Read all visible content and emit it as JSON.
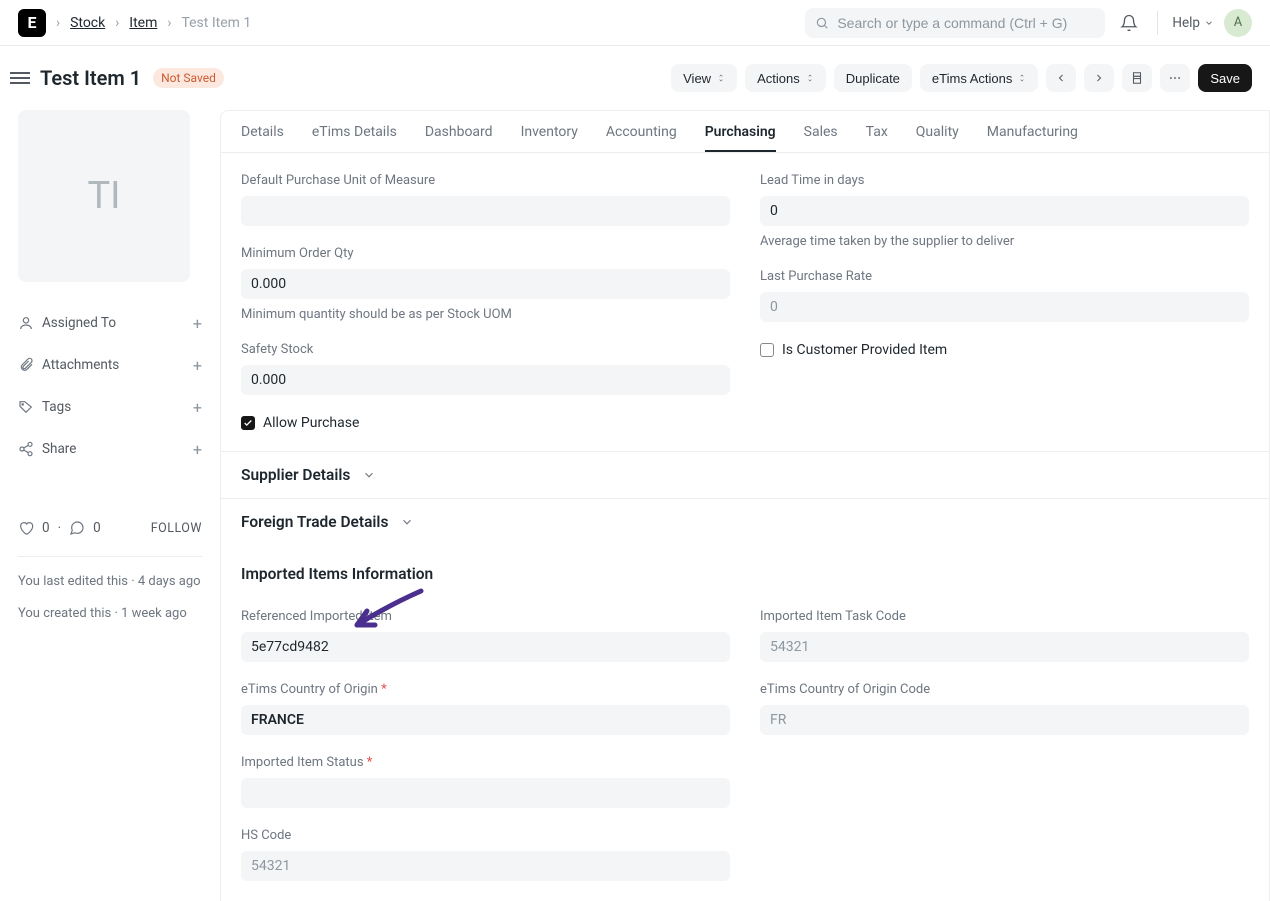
{
  "topbar": {
    "breadcrumbs": [
      "Stock",
      "Item",
      "Test Item 1"
    ],
    "search_placeholder": "Search or type a command (Ctrl + G)",
    "help_label": "Help",
    "avatar_initial": "A"
  },
  "header": {
    "title": "Test Item 1",
    "status_badge": "Not Saved",
    "buttons": {
      "view": "View",
      "actions": "Actions",
      "duplicate": "Duplicate",
      "etims_actions": "eTims Actions",
      "save": "Save"
    }
  },
  "sidebar": {
    "placeholder_initials": "TI",
    "items": [
      {
        "icon": "assigned",
        "label": "Assigned To"
      },
      {
        "icon": "attachment",
        "label": "Attachments"
      },
      {
        "icon": "tag",
        "label": "Tags"
      },
      {
        "icon": "share",
        "label": "Share"
      }
    ],
    "likes": "0",
    "comments": "0",
    "follow": "FOLLOW",
    "meta1": "You last edited this · 4 days ago",
    "meta2": "You created this · 1 week ago"
  },
  "tabs": [
    "Details",
    "eTims Details",
    "Dashboard",
    "Inventory",
    "Accounting",
    "Purchasing",
    "Sales",
    "Tax",
    "Quality",
    "Manufacturing"
  ],
  "active_tab": "Purchasing",
  "form": {
    "left": {
      "default_uom": {
        "label": "Default Purchase Unit of Measure",
        "value": ""
      },
      "min_order_qty": {
        "label": "Minimum Order Qty",
        "value": "0.000",
        "help": "Minimum quantity should be as per Stock UOM"
      },
      "safety_stock": {
        "label": "Safety Stock",
        "value": "0.000"
      },
      "allow_purchase": {
        "label": "Allow Purchase",
        "checked": true
      }
    },
    "right": {
      "lead_time": {
        "label": "Lead Time in days",
        "value": "0",
        "help": "Average time taken by the supplier to deliver"
      },
      "last_purchase_rate": {
        "label": "Last Purchase Rate",
        "value": "0"
      },
      "customer_provided": {
        "label": "Is Customer Provided Item",
        "checked": false
      }
    },
    "sections": {
      "supplier_details": "Supplier Details",
      "foreign_trade": "Foreign Trade Details",
      "imported_info": "Imported Items Information"
    },
    "imported": {
      "ref_item": {
        "label": "Referenced Imported Item",
        "value": "5e77cd9482"
      },
      "task_code": {
        "label": "Imported Item Task Code",
        "value": "54321"
      },
      "country_origin": {
        "label": "eTims Country of Origin",
        "value": "FRANCE",
        "required": true
      },
      "country_code": {
        "label": "eTims Country of Origin Code",
        "value": "FR"
      },
      "item_status": {
        "label": "Imported Item Status",
        "value": "",
        "required": true
      },
      "hs_code": {
        "label": "HS Code",
        "value": "54321"
      }
    }
  }
}
